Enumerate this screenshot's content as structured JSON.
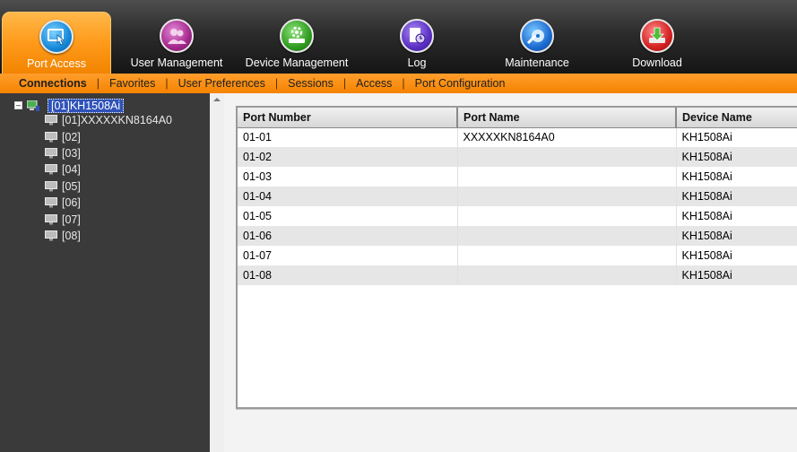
{
  "toolbar": {
    "items": [
      {
        "label": "Port Access",
        "icon": "port-access-icon",
        "active": true
      },
      {
        "label": "User Management",
        "icon": "user-management-icon",
        "active": false
      },
      {
        "label": "Device Management",
        "icon": "device-management-icon",
        "active": false
      },
      {
        "label": "Log",
        "icon": "log-icon",
        "active": false
      },
      {
        "label": "Maintenance",
        "icon": "maintenance-icon",
        "active": false
      },
      {
        "label": "Download",
        "icon": "download-icon",
        "active": false
      }
    ]
  },
  "subnav": {
    "items": [
      "Connections",
      "Favorites",
      "User Preferences",
      "Sessions",
      "Access",
      "Port Configuration"
    ],
    "active": "Connections"
  },
  "tree": {
    "root": "[01]KH1508Ai",
    "children": [
      "[01]XXXXXKN8164A0",
      "[02]",
      "[03]",
      "[04]",
      "[05]",
      "[06]",
      "[07]",
      "[08]"
    ]
  },
  "table": {
    "columns": [
      "Port Number",
      "Port Name",
      "Device Name"
    ],
    "rows": [
      [
        "01-01",
        "XXXXXKN8164A0",
        "KH1508Ai"
      ],
      [
        "01-02",
        "",
        "KH1508Ai"
      ],
      [
        "01-03",
        "",
        "KH1508Ai"
      ],
      [
        "01-04",
        "",
        "KH1508Ai"
      ],
      [
        "01-05",
        "",
        "KH1508Ai"
      ],
      [
        "01-06",
        "",
        "KH1508Ai"
      ],
      [
        "01-07",
        "",
        "KH1508Ai"
      ],
      [
        "01-08",
        "",
        "KH1508Ai"
      ]
    ]
  },
  "colors": {
    "accent_orange": "#f58300",
    "tree_bg": "#3a3a3a",
    "selected_blue": "#2f52b8"
  }
}
